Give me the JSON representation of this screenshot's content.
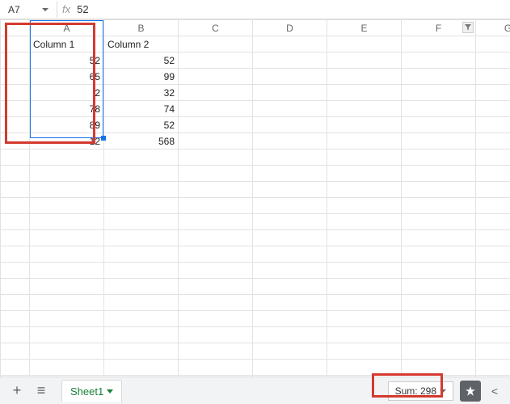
{
  "formula_bar": {
    "name_box": "A7",
    "fx_label": "fx",
    "value": "52"
  },
  "columns": [
    "A",
    "B",
    "C",
    "D",
    "E",
    "F",
    "G"
  ],
  "sheet": {
    "header_row": [
      "Column 1",
      "Column 2",
      "",
      "",
      "",
      "",
      ""
    ],
    "data": [
      [
        "52",
        "52",
        "",
        "",
        "",
        "",
        ""
      ],
      [
        "65",
        "99",
        "",
        "",
        "",
        "",
        ""
      ],
      [
        "2",
        "32",
        "",
        "",
        "",
        "",
        ""
      ],
      [
        "78",
        "74",
        "",
        "",
        "",
        "",
        ""
      ],
      [
        "89",
        "52",
        "",
        "",
        "",
        "",
        ""
      ],
      [
        "12",
        "568",
        "",
        "",
        "",
        "",
        ""
      ]
    ],
    "blank_row_count": 15
  },
  "bottom_bar": {
    "sheet_name": "Sheet1",
    "summary_label": "Sum: 298"
  },
  "icons": {
    "add": "+",
    "all_sheets": "≡",
    "side_toggle": "<"
  }
}
